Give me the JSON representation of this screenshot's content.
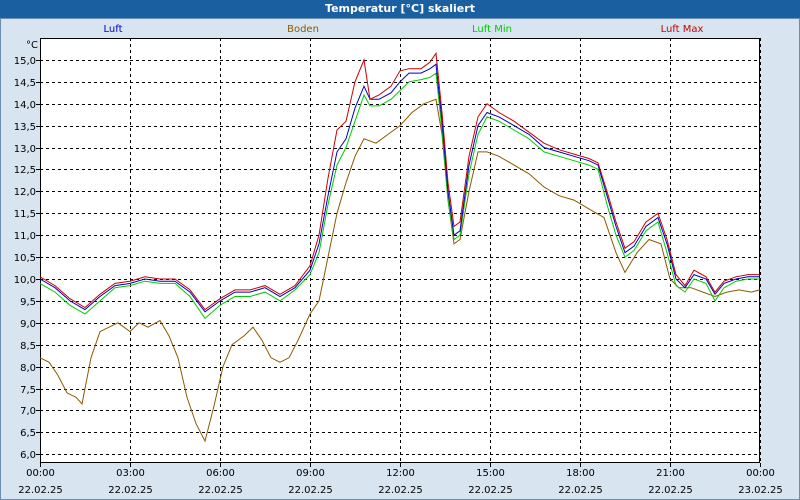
{
  "window": {
    "title": "Temperatur [°C] skaliert"
  },
  "chart_data": {
    "type": "line",
    "title": "Temperatur [°C] skaliert",
    "ylabel": "°C",
    "ylim": [
      5.8,
      15.5
    ],
    "xlim": [
      0,
      24
    ],
    "grid": true,
    "legend_position": "top",
    "yticks": [
      6.0,
      6.5,
      7.0,
      7.5,
      8.0,
      8.5,
      9.0,
      9.5,
      10.0,
      10.5,
      11.0,
      11.5,
      12.0,
      12.5,
      13.0,
      13.5,
      14.0,
      14.5,
      15.0
    ],
    "ytick_labels": [
      "6,0",
      "6,5",
      "7,0",
      "7,5",
      "8,0",
      "8,5",
      "9,0",
      "9,5",
      "10,0",
      "10,5",
      "11,0",
      "11,5",
      "12,0",
      "12,5",
      "13,0",
      "13,5",
      "14,0",
      "14,5",
      "15,0"
    ],
    "xticks": [
      {
        "hour": 0,
        "time": "00:00",
        "date": "22.02.25"
      },
      {
        "hour": 3,
        "time": "03:00",
        "date": "22.02.25"
      },
      {
        "hour": 6,
        "time": "06:00",
        "date": "22.02.25"
      },
      {
        "hour": 9,
        "time": "09:00",
        "date": "22.02.25"
      },
      {
        "hour": 12,
        "time": "12:00",
        "date": "22.02.25"
      },
      {
        "hour": 15,
        "time": "15:00",
        "date": "22.02.25"
      },
      {
        "hour": 18,
        "time": "18:00",
        "date": "22.02.25"
      },
      {
        "hour": 21,
        "time": "21:00",
        "date": "22.02.25"
      },
      {
        "hour": 24,
        "time": "00:00",
        "date": "23.02.25"
      }
    ],
    "series": [
      {
        "name": "Luft",
        "color": "#0000cc",
        "points": [
          [
            0,
            10.0
          ],
          [
            0.5,
            9.8
          ],
          [
            1,
            9.5
          ],
          [
            1.5,
            9.3
          ],
          [
            2,
            9.6
          ],
          [
            2.5,
            9.85
          ],
          [
            3,
            9.9
          ],
          [
            3.5,
            10.0
          ],
          [
            4,
            9.95
          ],
          [
            4.5,
            9.95
          ],
          [
            5,
            9.7
          ],
          [
            5.5,
            9.25
          ],
          [
            6,
            9.5
          ],
          [
            6.5,
            9.7
          ],
          [
            7,
            9.7
          ],
          [
            7.5,
            9.8
          ],
          [
            8,
            9.6
          ],
          [
            8.5,
            9.8
          ],
          [
            9,
            10.2
          ],
          [
            9.3,
            10.8
          ],
          [
            9.6,
            11.9
          ],
          [
            9.9,
            12.9
          ],
          [
            10.2,
            13.2
          ],
          [
            10.5,
            13.9
          ],
          [
            10.8,
            14.4
          ],
          [
            11.0,
            14.1
          ],
          [
            11.3,
            14.1
          ],
          [
            11.7,
            14.25
          ],
          [
            12,
            14.5
          ],
          [
            12.3,
            14.7
          ],
          [
            12.7,
            14.7
          ],
          [
            13,
            14.8
          ],
          [
            13.2,
            14.9
          ],
          [
            13.4,
            13.6
          ],
          [
            13.6,
            12.0
          ],
          [
            13.8,
            11.0
          ],
          [
            14,
            11.1
          ],
          [
            14.3,
            12.6
          ],
          [
            14.6,
            13.5
          ],
          [
            14.9,
            13.8
          ],
          [
            15.3,
            13.7
          ],
          [
            15.8,
            13.5
          ],
          [
            16.3,
            13.3
          ],
          [
            16.8,
            13.0
          ],
          [
            17.3,
            12.9
          ],
          [
            17.8,
            12.8
          ],
          [
            18.3,
            12.7
          ],
          [
            18.6,
            12.6
          ],
          [
            18.9,
            11.9
          ],
          [
            19.2,
            11.2
          ],
          [
            19.5,
            10.6
          ],
          [
            19.8,
            10.75
          ],
          [
            20.2,
            11.2
          ],
          [
            20.6,
            11.4
          ],
          [
            20.9,
            10.8
          ],
          [
            21.2,
            10.0
          ],
          [
            21.5,
            9.8
          ],
          [
            21.8,
            10.1
          ],
          [
            22.2,
            10.0
          ],
          [
            22.5,
            9.65
          ],
          [
            22.8,
            9.9
          ],
          [
            23.2,
            10.0
          ],
          [
            23.6,
            10.05
          ],
          [
            24,
            10.05
          ]
        ]
      },
      {
        "name": "Boden",
        "color": "#8b5a00",
        "points": [
          [
            0,
            8.2
          ],
          [
            0.3,
            8.1
          ],
          [
            0.6,
            7.8
          ],
          [
            0.9,
            7.4
          ],
          [
            1.2,
            7.3
          ],
          [
            1.4,
            7.15
          ],
          [
            1.7,
            8.2
          ],
          [
            2,
            8.8
          ],
          [
            2.3,
            8.9
          ],
          [
            2.6,
            9.0
          ],
          [
            3,
            8.8
          ],
          [
            3.3,
            9.0
          ],
          [
            3.6,
            8.9
          ],
          [
            4,
            9.05
          ],
          [
            4.3,
            8.7
          ],
          [
            4.6,
            8.2
          ],
          [
            4.9,
            7.3
          ],
          [
            5.2,
            6.7
          ],
          [
            5.5,
            6.3
          ],
          [
            5.8,
            7.1
          ],
          [
            6.1,
            8.0
          ],
          [
            6.4,
            8.5
          ],
          [
            6.8,
            8.7
          ],
          [
            7.1,
            8.9
          ],
          [
            7.4,
            8.6
          ],
          [
            7.7,
            8.2
          ],
          [
            8.0,
            8.1
          ],
          [
            8.3,
            8.2
          ],
          [
            8.6,
            8.6
          ],
          [
            9.0,
            9.2
          ],
          [
            9.3,
            9.5
          ],
          [
            9.6,
            10.5
          ],
          [
            9.9,
            11.5
          ],
          [
            10.2,
            12.2
          ],
          [
            10.5,
            12.8
          ],
          [
            10.8,
            13.2
          ],
          [
            11.2,
            13.1
          ],
          [
            11.6,
            13.3
          ],
          [
            12,
            13.5
          ],
          [
            12.4,
            13.8
          ],
          [
            12.8,
            14.0
          ],
          [
            13.2,
            14.1
          ],
          [
            13.4,
            13.3
          ],
          [
            13.6,
            11.8
          ],
          [
            13.8,
            10.8
          ],
          [
            14.0,
            10.9
          ],
          [
            14.3,
            12.0
          ],
          [
            14.6,
            12.9
          ],
          [
            14.9,
            12.9
          ],
          [
            15.3,
            12.8
          ],
          [
            15.8,
            12.6
          ],
          [
            16.3,
            12.4
          ],
          [
            16.8,
            12.1
          ],
          [
            17.3,
            11.9
          ],
          [
            17.8,
            11.8
          ],
          [
            18.3,
            11.6
          ],
          [
            18.8,
            11.4
          ],
          [
            19.2,
            10.6
          ],
          [
            19.5,
            10.15
          ],
          [
            19.9,
            10.6
          ],
          [
            20.3,
            10.9
          ],
          [
            20.7,
            10.8
          ],
          [
            21.0,
            10.0
          ],
          [
            21.3,
            9.8
          ],
          [
            21.7,
            9.8
          ],
          [
            22.1,
            9.7
          ],
          [
            22.5,
            9.6
          ],
          [
            22.9,
            9.7
          ],
          [
            23.3,
            9.75
          ],
          [
            23.7,
            9.7
          ],
          [
            24,
            9.75
          ]
        ]
      },
      {
        "name": "Luft Min",
        "color": "#00cc00",
        "points": [
          [
            0,
            9.9
          ],
          [
            0.5,
            9.7
          ],
          [
            1,
            9.4
          ],
          [
            1.5,
            9.2
          ],
          [
            2,
            9.5
          ],
          [
            2.5,
            9.8
          ],
          [
            3,
            9.85
          ],
          [
            3.5,
            9.95
          ],
          [
            4,
            9.9
          ],
          [
            4.5,
            9.9
          ],
          [
            5,
            9.6
          ],
          [
            5.5,
            9.1
          ],
          [
            6,
            9.4
          ],
          [
            6.5,
            9.6
          ],
          [
            7,
            9.6
          ],
          [
            7.5,
            9.7
          ],
          [
            8,
            9.5
          ],
          [
            8.5,
            9.75
          ],
          [
            9,
            10.1
          ],
          [
            9.3,
            10.6
          ],
          [
            9.6,
            11.7
          ],
          [
            9.9,
            12.6
          ],
          [
            10.2,
            13.0
          ],
          [
            10.5,
            13.6
          ],
          [
            10.8,
            14.2
          ],
          [
            11.0,
            13.95
          ],
          [
            11.3,
            13.95
          ],
          [
            11.7,
            14.1
          ],
          [
            12,
            14.3
          ],
          [
            12.3,
            14.5
          ],
          [
            12.7,
            14.55
          ],
          [
            13,
            14.6
          ],
          [
            13.2,
            14.7
          ],
          [
            13.4,
            13.4
          ],
          [
            13.6,
            11.8
          ],
          [
            13.8,
            10.9
          ],
          [
            14,
            11.0
          ],
          [
            14.3,
            12.4
          ],
          [
            14.6,
            13.3
          ],
          [
            14.9,
            13.7
          ],
          [
            15.3,
            13.6
          ],
          [
            15.8,
            13.4
          ],
          [
            16.3,
            13.2
          ],
          [
            16.8,
            12.9
          ],
          [
            17.3,
            12.8
          ],
          [
            17.8,
            12.7
          ],
          [
            18.3,
            12.6
          ],
          [
            18.6,
            12.5
          ],
          [
            18.9,
            11.7
          ],
          [
            19.2,
            11.0
          ],
          [
            19.5,
            10.5
          ],
          [
            19.8,
            10.65
          ],
          [
            20.2,
            11.1
          ],
          [
            20.6,
            11.3
          ],
          [
            20.9,
            10.6
          ],
          [
            21.2,
            9.85
          ],
          [
            21.5,
            9.7
          ],
          [
            21.8,
            10.0
          ],
          [
            22.2,
            9.9
          ],
          [
            22.5,
            9.5
          ],
          [
            22.8,
            9.8
          ],
          [
            23.2,
            9.95
          ],
          [
            23.6,
            10.0
          ],
          [
            24,
            10.0
          ]
        ]
      },
      {
        "name": "Luft Max",
        "color": "#cc0000",
        "points": [
          [
            0,
            10.05
          ],
          [
            0.5,
            9.85
          ],
          [
            1,
            9.55
          ],
          [
            1.5,
            9.35
          ],
          [
            2,
            9.65
          ],
          [
            2.5,
            9.9
          ],
          [
            3,
            9.95
          ],
          [
            3.5,
            10.05
          ],
          [
            4,
            10.0
          ],
          [
            4.5,
            10.0
          ],
          [
            5,
            9.75
          ],
          [
            5.5,
            9.3
          ],
          [
            6,
            9.55
          ],
          [
            6.5,
            9.75
          ],
          [
            7,
            9.75
          ],
          [
            7.5,
            9.85
          ],
          [
            8,
            9.65
          ],
          [
            8.5,
            9.85
          ],
          [
            9,
            10.3
          ],
          [
            9.3,
            11.0
          ],
          [
            9.6,
            12.3
          ],
          [
            9.9,
            13.4
          ],
          [
            10.2,
            13.6
          ],
          [
            10.5,
            14.5
          ],
          [
            10.8,
            15.0
          ],
          [
            11.0,
            14.1
          ],
          [
            11.3,
            14.2
          ],
          [
            11.7,
            14.4
          ],
          [
            12,
            14.75
          ],
          [
            12.3,
            14.8
          ],
          [
            12.7,
            14.8
          ],
          [
            13,
            14.95
          ],
          [
            13.2,
            15.15
          ],
          [
            13.4,
            13.8
          ],
          [
            13.6,
            12.2
          ],
          [
            13.8,
            11.2
          ],
          [
            14,
            11.3
          ],
          [
            14.3,
            12.8
          ],
          [
            14.6,
            13.7
          ],
          [
            14.9,
            14.0
          ],
          [
            15.3,
            13.8
          ],
          [
            15.8,
            13.6
          ],
          [
            16.3,
            13.35
          ],
          [
            16.8,
            13.1
          ],
          [
            17.3,
            12.95
          ],
          [
            17.8,
            12.85
          ],
          [
            18.3,
            12.75
          ],
          [
            18.6,
            12.65
          ],
          [
            18.9,
            12.0
          ],
          [
            19.2,
            11.3
          ],
          [
            19.5,
            10.7
          ],
          [
            19.8,
            10.85
          ],
          [
            20.2,
            11.3
          ],
          [
            20.6,
            11.5
          ],
          [
            20.9,
            10.9
          ],
          [
            21.2,
            10.1
          ],
          [
            21.5,
            9.85
          ],
          [
            21.8,
            10.2
          ],
          [
            22.2,
            10.05
          ],
          [
            22.5,
            9.7
          ],
          [
            22.8,
            9.95
          ],
          [
            23.2,
            10.05
          ],
          [
            23.6,
            10.1
          ],
          [
            24,
            10.1
          ]
        ]
      }
    ]
  }
}
